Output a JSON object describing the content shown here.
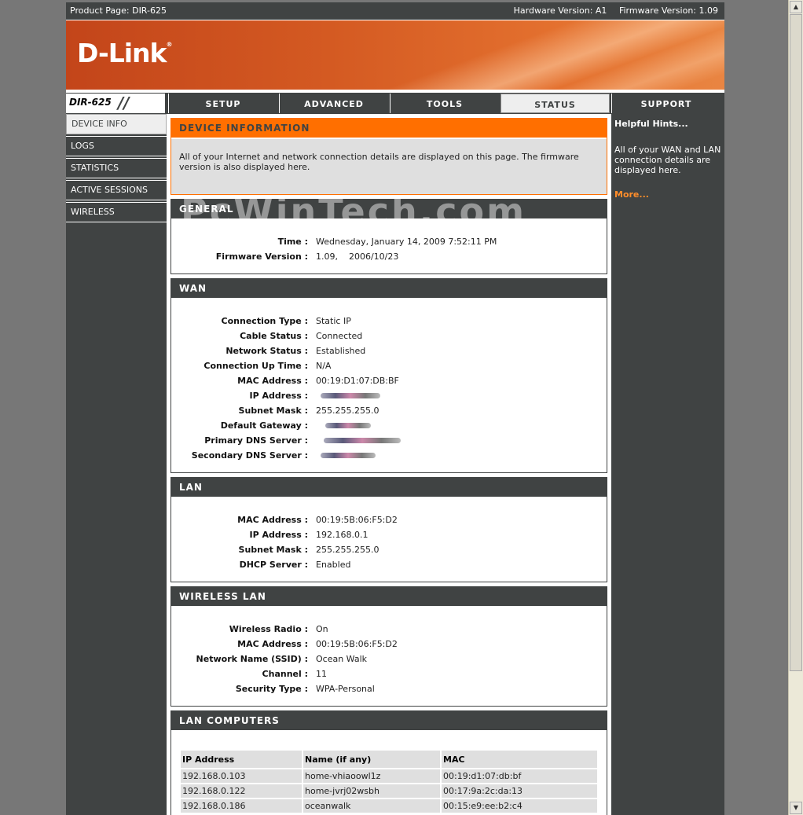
{
  "topbar": {
    "product_page": "Product Page: DIR-625",
    "hardware_version": "Hardware Version: A1",
    "firmware_version": "Firmware Version: 1.09"
  },
  "brand": {
    "logo_text": "D-Link",
    "model": "DIR-625"
  },
  "nav_tabs": [
    "SETUP",
    "ADVANCED",
    "TOOLS",
    "STATUS",
    "SUPPORT"
  ],
  "active_tab": "STATUS",
  "sidebar": {
    "items": [
      "DEVICE INFO",
      "LOGS",
      "STATISTICS",
      "ACTIVE SESSIONS",
      "WIRELESS"
    ],
    "active": "DEVICE INFO"
  },
  "device_info": {
    "title": "DEVICE INFORMATION",
    "description": "All of your Internet and network connection details are displayed on this page. The firmware version is also displayed here."
  },
  "general": {
    "title": "GENERAL",
    "rows": [
      {
        "label": "Time :",
        "value": "Wednesday, January 14, 2009 7:52:11 PM"
      },
      {
        "label": "Firmware Version :",
        "value": "1.09,    2006/10/23"
      }
    ]
  },
  "wan": {
    "title": "WAN",
    "rows": [
      {
        "label": "Connection Type :",
        "value": "Static IP"
      },
      {
        "label": "Cable Status :",
        "value": "Connected"
      },
      {
        "label": "Network Status :",
        "value": "Established"
      },
      {
        "label": "Connection Up Time :",
        "value": "N/A"
      },
      {
        "label": "MAC Address :",
        "value": "00:19:D1:07:DB:BF"
      },
      {
        "label": "IP Address :",
        "value": ""
      },
      {
        "label": "Subnet Mask :",
        "value": "255.255.255.0"
      },
      {
        "label": "Default Gateway :",
        "value": ""
      },
      {
        "label": "Primary DNS Server :",
        "value": ""
      },
      {
        "label": "Secondary DNS Server :",
        "value": ""
      }
    ]
  },
  "lan": {
    "title": "LAN",
    "rows": [
      {
        "label": "MAC Address :",
        "value": "00:19:5B:06:F5:D2"
      },
      {
        "label": "IP Address :",
        "value": "192.168.0.1"
      },
      {
        "label": "Subnet Mask :",
        "value": "255.255.255.0"
      },
      {
        "label": "DHCP Server :",
        "value": "Enabled"
      }
    ]
  },
  "wireless_lan": {
    "title": "WIRELESS LAN",
    "rows": [
      {
        "label": "Wireless Radio :",
        "value": "On"
      },
      {
        "label": "MAC Address :",
        "value": "00:19:5B:06:F5:D2"
      },
      {
        "label": "Network Name (SSID) :",
        "value": "Ocean Walk"
      },
      {
        "label": "Channel :",
        "value": "11"
      },
      {
        "label": "Security Type :",
        "value": "WPA-Personal"
      }
    ]
  },
  "lan_computers": {
    "title": "LAN COMPUTERS",
    "columns": [
      "IP Address",
      "Name (if any)",
      "MAC"
    ],
    "rows": [
      [
        "192.168.0.103",
        "home-vhiaoowl1z",
        "00:19:d1:07:db:bf"
      ],
      [
        "192.168.0.122",
        "home-jvrj02wsbh",
        "00:17:9a:2c:da:13"
      ],
      [
        "192.168.0.186",
        "oceanwalk",
        "00:15:e9:ee:b2:c4"
      ]
    ]
  },
  "hints": {
    "title": "Helpful Hints...",
    "text": "All of your WAN and LAN connection details are displayed here.",
    "more": "More..."
  },
  "watermark": "PcWinTech.com",
  "colors": {
    "accent": "#ff6f00",
    "dark": "#404343",
    "banner": "#d45a22"
  }
}
